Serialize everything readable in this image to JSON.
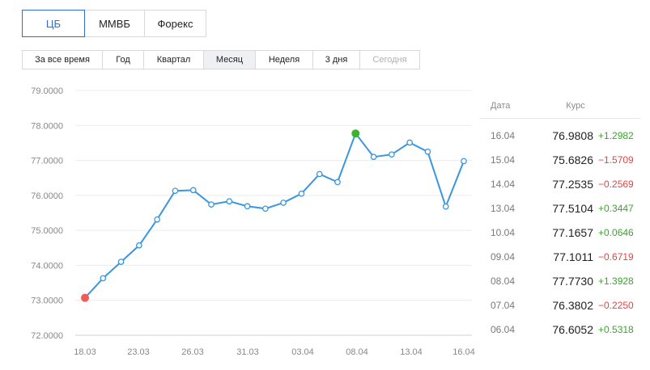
{
  "source_tabs": [
    {
      "label": "ЦБ",
      "active": true
    },
    {
      "label": "ММВБ",
      "active": false
    },
    {
      "label": "Форекс",
      "active": false
    }
  ],
  "period_tabs": [
    {
      "label": "За все время",
      "active": false,
      "disabled": false
    },
    {
      "label": "Год",
      "active": false,
      "disabled": false
    },
    {
      "label": "Квартал",
      "active": false,
      "disabled": false
    },
    {
      "label": "Месяц",
      "active": true,
      "disabled": false
    },
    {
      "label": "Неделя",
      "active": false,
      "disabled": false
    },
    {
      "label": "3 дня",
      "active": false,
      "disabled": false
    },
    {
      "label": "Сегодня",
      "active": false,
      "disabled": true
    }
  ],
  "colors": {
    "accent": "#2b6fd6",
    "line": "#3b96e0",
    "min_marker": "#f05a5a",
    "max_marker": "#3ab52a",
    "positive": "#3aa62a",
    "negative": "#e24646"
  },
  "chart_data": {
    "type": "line",
    "ylim": [
      72.0,
      79.0
    ],
    "y_ticks": [
      "79.0000",
      "78.0000",
      "77.0000",
      "76.0000",
      "75.0000",
      "74.0000",
      "73.0000",
      "72.0000"
    ],
    "x_tick_labels": [
      "18.03",
      "23.03",
      "26.03",
      "31.03",
      "03.04",
      "08.04",
      "13.04",
      "16.04"
    ],
    "grid": true,
    "x": [
      "18.03",
      "19.03",
      "20.03",
      "21.03",
      "22.03",
      "23.03",
      "24.03",
      "25.03",
      "26.03",
      "27.03",
      "28.03",
      "29.03",
      "30.03",
      "31.03",
      "01.04",
      "02.04",
      "03.04",
      "04.04",
      "05.04",
      "06.04",
      "07.04",
      "08.04",
      "09.04",
      "10.04",
      "11.04",
      "12.04",
      "13.04",
      "14.04",
      "15.04",
      "16.04"
    ],
    "series": [
      {
        "values": [
          73.07,
          73.63,
          74.1,
          74.57,
          75.31,
          76.13,
          76.15,
          75.74,
          75.83,
          75.69,
          75.62,
          75.79,
          76.05,
          76.61,
          76.38,
          77.77,
          77.1,
          77.17,
          77.51,
          77.25,
          75.68,
          76.98
        ],
        "x_index": [
          0,
          1,
          2,
          3,
          4,
          5,
          6,
          7,
          8,
          9,
          10,
          11,
          12,
          13,
          14,
          15,
          16,
          17,
          18,
          19,
          20,
          21
        ]
      }
    ],
    "min_point_index": 0,
    "max_point_index": 15
  },
  "rates": {
    "header_date": "Дата",
    "header_rate": "Курс",
    "rows": [
      {
        "date": "16.04",
        "value": "76.9808",
        "change": "+1.2982",
        "positive": true
      },
      {
        "date": "15.04",
        "value": "75.6826",
        "change": "−1.5709",
        "positive": false
      },
      {
        "date": "14.04",
        "value": "77.2535",
        "change": "−0.2569",
        "positive": false
      },
      {
        "date": "13.04",
        "value": "77.5104",
        "change": "+0.3447",
        "positive": true
      },
      {
        "date": "10.04",
        "value": "77.1657",
        "change": "+0.0646",
        "positive": true
      },
      {
        "date": "09.04",
        "value": "77.1011",
        "change": "−0.6719",
        "positive": false
      },
      {
        "date": "08.04",
        "value": "77.7730",
        "change": "+1.3928",
        "positive": true
      },
      {
        "date": "07.04",
        "value": "76.3802",
        "change": "−0.2250",
        "positive": false
      },
      {
        "date": "06.04",
        "value": "76.6052",
        "change": "+0.5318",
        "positive": true
      }
    ]
  }
}
